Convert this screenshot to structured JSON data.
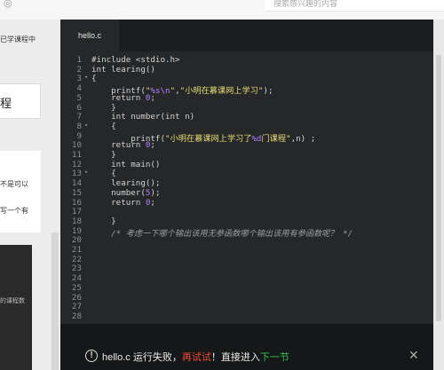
{
  "header": {
    "top_icon": "eye-icon",
    "search_placeholder": "搜索感兴趣的内容"
  },
  "left": {
    "text1": "已学课程中",
    "box_text": "程",
    "text2": "不是可以",
    "text3": "写一个有",
    "text4": "的课程数"
  },
  "editor": {
    "tab_label": "hello.c",
    "lines": [
      {
        "n": "1",
        "fold": "",
        "html": "#include &lt;stdio.h&gt;"
      },
      {
        "n": "2",
        "fold": "",
        "html": "int learing()"
      },
      {
        "n": "3",
        "fold": "▾",
        "html": "{"
      },
      {
        "n": "4",
        "fold": "",
        "html": "    printf(\"%s\\n\",\"小明在慕课网上学习\");"
      },
      {
        "n": "5",
        "fold": "",
        "html": "    return 0;"
      },
      {
        "n": "6",
        "fold": "",
        "html": "    }"
      },
      {
        "n": "7",
        "fold": "",
        "html": "    int number(int n)"
      },
      {
        "n": "8",
        "fold": "▾",
        "html": "    {"
      },
      {
        "n": "9",
        "fold": "",
        "html": "        printf(\"小明在慕课网上学习了%d门课程\",n) ;"
      },
      {
        "n": "10",
        "fold": "",
        "html": "    return 0;"
      },
      {
        "n": "11",
        "fold": "",
        "html": "    }"
      },
      {
        "n": "12",
        "fold": "",
        "html": "    int main()"
      },
      {
        "n": "13",
        "fold": "▾",
        "html": "    {"
      },
      {
        "n": "14",
        "fold": "",
        "html": "    learing();"
      },
      {
        "n": "15",
        "fold": "",
        "html": "    number(5);"
      },
      {
        "n": "16",
        "fold": "",
        "html": "    return 0;"
      },
      {
        "n": "17",
        "fold": "",
        "html": ""
      },
      {
        "n": "18",
        "fold": "",
        "html": "    }"
      },
      {
        "n": "19",
        "fold": "",
        "html": "    /* 考虑一下哪个输出该用无参函数哪个输出该用有参函数呢？ */"
      },
      {
        "n": "20",
        "fold": "",
        "html": ""
      },
      {
        "n": "21",
        "fold": "",
        "html": ""
      },
      {
        "n": "22",
        "fold": "",
        "html": ""
      },
      {
        "n": "23",
        "fold": "",
        "html": ""
      },
      {
        "n": "24",
        "fold": "",
        "html": ""
      },
      {
        "n": "25",
        "fold": "",
        "html": ""
      },
      {
        "n": "26",
        "fold": "",
        "html": ""
      },
      {
        "n": "27",
        "fold": "",
        "html": ""
      },
      {
        "n": "28",
        "fold": "",
        "html": ""
      }
    ]
  },
  "toast": {
    "icon": "alert-circle-icon",
    "part1": "hello.c 运行失败，",
    "retry": "再试试",
    "part2": "！直接进入",
    "next": "下一节",
    "close": "✕"
  }
}
